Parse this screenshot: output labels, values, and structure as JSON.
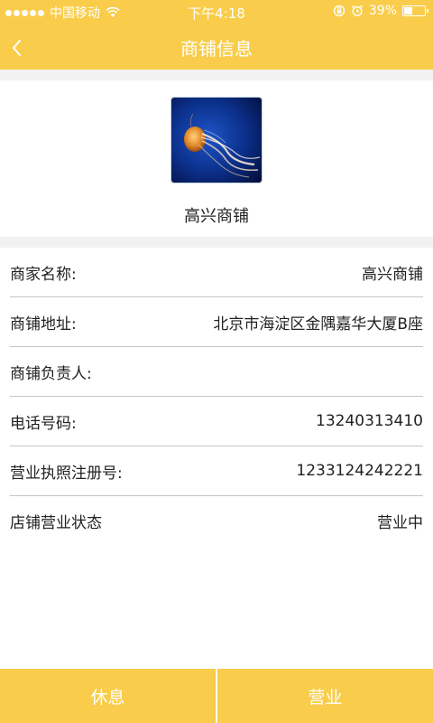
{
  "status_bar": {
    "carrier": "中国移动",
    "time": "下午4:18",
    "battery": "39%",
    "battery_level": 0.39
  },
  "header": {
    "title": "商铺信息"
  },
  "profile": {
    "shop_name": "高兴商铺"
  },
  "info": [
    {
      "label": "商家名称:",
      "value": "高兴商铺"
    },
    {
      "label": "商铺地址:",
      "value": "北京市海淀区金隅嘉华大厦B座"
    },
    {
      "label": "商铺负责人:",
      "value": ""
    },
    {
      "label": "电话号码:",
      "value": "13240313410"
    },
    {
      "label": "营业执照注册号:",
      "value": "1233124242221"
    },
    {
      "label": "店铺营业状态",
      "value": "营业中"
    }
  ],
  "footer": {
    "rest_label": "休息",
    "open_label": "营业"
  },
  "colors": {
    "accent": "#f9cd4b"
  }
}
